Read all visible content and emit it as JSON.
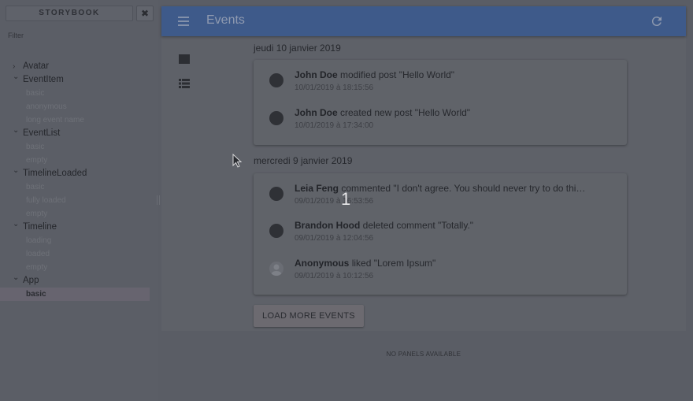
{
  "sidebar": {
    "title": "STORYBOOK",
    "close_icon": "close-icon",
    "filter_placeholder": "Filter",
    "tree": [
      {
        "kind": "Avatar",
        "expanded": false,
        "stories": []
      },
      {
        "kind": "EventItem",
        "expanded": true,
        "stories": [
          "basic",
          "anonymous",
          "long event name"
        ]
      },
      {
        "kind": "EventList",
        "expanded": true,
        "stories": [
          "basic",
          "empty"
        ]
      },
      {
        "kind": "TimelineLoaded",
        "expanded": true,
        "stories": [
          "basic",
          "fully loaded",
          "empty"
        ]
      },
      {
        "kind": "Timeline",
        "expanded": true,
        "stories": [
          "loading",
          "loaded",
          "empty"
        ]
      },
      {
        "kind": "App",
        "expanded": true,
        "stories": [
          "basic"
        ],
        "selected": "basic"
      }
    ]
  },
  "app": {
    "title": "Events",
    "menu_icon": "menu-icon",
    "refresh_icon": "refresh-icon",
    "rail_icons": [
      "view-module-icon",
      "view-list-icon"
    ],
    "accent_color": "#3e5a8a"
  },
  "timeline": [
    {
      "date": "jeudi 10 janvier 2019",
      "events": [
        {
          "actor": "John Doe",
          "text": "modified post \"Hello World\"",
          "time": "10/01/2019 à 18:15:56",
          "anonymous": false
        },
        {
          "actor": "John Doe",
          "text": "created new post \"Hello World\"",
          "time": "10/01/2019 à 17:34:00",
          "anonymous": false
        }
      ]
    },
    {
      "date": "mercredi 9 janvier 2019",
      "events": [
        {
          "actor": "Leia Feng",
          "text": "commented \"I don't agree. You should never try to do thi…",
          "time": "09/01/2019 à 16:53:56",
          "anonymous": false
        },
        {
          "actor": "Brandon Hood",
          "text": "deleted comment \"Totally.\"",
          "time": "09/01/2019 à 12:04:56",
          "anonymous": false
        },
        {
          "actor": "Anonymous",
          "text": "liked \"Lorem Ipsum\"",
          "time": "09/01/2019 à 10:12:56",
          "anonymous": true
        }
      ]
    }
  ],
  "load_more_label": "LOAD MORE EVENTS",
  "no_panels_label": "NO PANELS AVAILABLE",
  "step_marker": "1"
}
